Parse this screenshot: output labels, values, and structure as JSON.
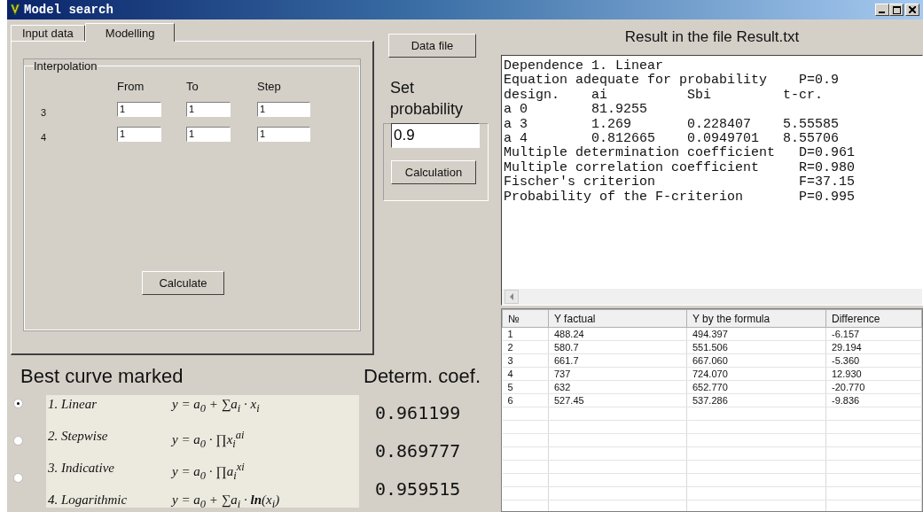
{
  "window": {
    "title": "Model search"
  },
  "tabs": [
    {
      "label": "Input data",
      "selected": false
    },
    {
      "label": "Modelling",
      "selected": true
    }
  ],
  "interpolation": {
    "title": "Interpolation",
    "columns": [
      "From",
      "To",
      "Step"
    ],
    "rows": [
      {
        "label": "3",
        "values": [
          "1",
          "1",
          "1"
        ]
      },
      {
        "label": "4",
        "values": [
          "1",
          "1",
          "1"
        ]
      }
    ],
    "button": "Calculate"
  },
  "data_file_button": "Data file",
  "probability": {
    "label": "Set probability",
    "value": "0.9",
    "button": "Calculation"
  },
  "result": {
    "title": "Result in the file Result.txt",
    "lines": [
      "Dependence 1. Linear",
      "Equation adequate for probability    P=0.9",
      "design.    ai          Sbi         t-cr.",
      "a 0        81.9255",
      "a 3        1.269       0.228407    5.55585",
      "a 4        0.812665    0.0949701   8.55706",
      "Multiple determination coefficient   D=0.961",
      "Multiple correlation coefficient     R=0.980",
      "Fischer's criterion                  F=37.15",
      "Probability of the F-criterion       P=0.995"
    ]
  },
  "table": {
    "columns": [
      "№",
      "Y factual",
      "Y by the formula",
      "Difference"
    ],
    "rows": [
      [
        "1",
        "488.24",
        "494.397",
        "-6.157"
      ],
      [
        "2",
        "580.7",
        "551.506",
        "29.194"
      ],
      [
        "3",
        "661.7",
        "667.060",
        "-5.360"
      ],
      [
        "4",
        "737",
        "724.070",
        "12.930"
      ],
      [
        "5",
        "632",
        "652.770",
        "-20.770"
      ],
      [
        "6",
        "527.45",
        "537.286",
        "-9.836"
      ]
    ]
  },
  "best_curve": {
    "title": "Best curve marked",
    "coef_title": "Determ. coef.",
    "choices": [
      {
        "selected": true
      },
      {
        "selected": false
      },
      {
        "selected": false
      }
    ],
    "models": [
      {
        "name": "1. Linear",
        "formula": "y = a$_{0}$ + ∑a$_{i}$ · x$_{i}$"
      },
      {
        "name": "2. Stepwise",
        "formula": "y = a$_{0}$ · ∏x$_{i}$$^{ai}$"
      },
      {
        "name": "3. Indicative",
        "formula": "y = a$_{0}$ · ∏a$_{i}$$^{xi}$"
      },
      {
        "name": "4. Logarithmic",
        "formula": "y = a$_{0}$ + ∑a$_{i}$ · **ln**(x$_{i}$)"
      }
    ],
    "coefficients": [
      "0.961199",
      "0.869777",
      "0.959515"
    ]
  }
}
